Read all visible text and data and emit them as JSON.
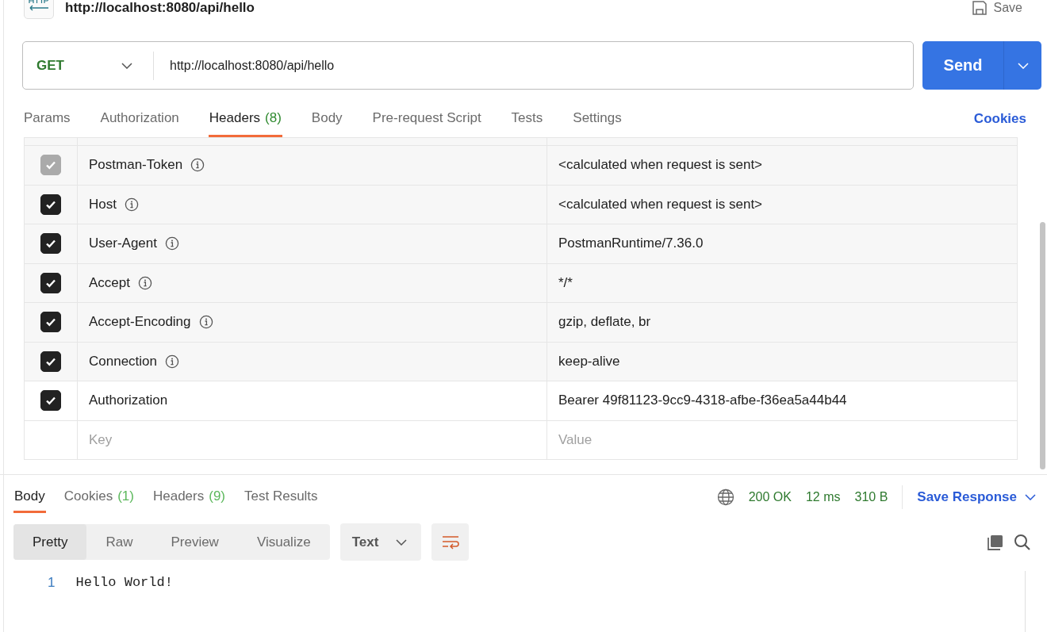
{
  "request": {
    "title": "http://localhost:8080/api/hello",
    "save_label": "Save",
    "method": "GET",
    "url": "http://localhost:8080/api/hello",
    "send_label": "Send"
  },
  "request_tabs": [
    {
      "label": "Params",
      "selected": false
    },
    {
      "label": "Authorization",
      "selected": false
    },
    {
      "label": "Headers",
      "count": "(8)",
      "selected": true
    },
    {
      "label": "Body",
      "selected": false
    },
    {
      "label": "Pre-request Script",
      "selected": false
    },
    {
      "label": "Tests",
      "selected": false
    },
    {
      "label": "Settings",
      "selected": false
    }
  ],
  "cookies_link": "Cookies",
  "headers": [
    {
      "key": "Postman-Token",
      "value": "<calculated when request is sent>",
      "checked": true,
      "disabled": true,
      "hint": true
    },
    {
      "key": "Host",
      "value": "<calculated when request is sent>",
      "checked": true,
      "disabled": false,
      "hint": true
    },
    {
      "key": "User-Agent",
      "value": "PostmanRuntime/7.36.0",
      "checked": true,
      "disabled": false,
      "hint": true
    },
    {
      "key": "Accept",
      "value": "*/*",
      "checked": true,
      "disabled": false,
      "hint": true
    },
    {
      "key": "Accept-Encoding",
      "value": "gzip, deflate, br",
      "checked": true,
      "disabled": false,
      "hint": true
    },
    {
      "key": "Connection",
      "value": "keep-alive",
      "checked": true,
      "disabled": false,
      "hint": true
    },
    {
      "key": "Authorization",
      "value": "Bearer 49f81123-9cc9-4318-afbe-f36ea5a44b44",
      "checked": true,
      "disabled": false,
      "hint": false
    }
  ],
  "new_header": {
    "key_placeholder": "Key",
    "value_placeholder": "Value"
  },
  "response_tabs": [
    {
      "label": "Body",
      "selected": true
    },
    {
      "label": "Cookies",
      "count": "(1)",
      "selected": false
    },
    {
      "label": "Headers",
      "count": "(9)",
      "selected": false
    },
    {
      "label": "Test Results",
      "selected": false
    }
  ],
  "status": {
    "code": "200 OK",
    "time": "12 ms",
    "size": "310 B",
    "save_label": "Save Response"
  },
  "view_modes": [
    {
      "label": "Pretty",
      "selected": true
    },
    {
      "label": "Raw",
      "selected": false
    },
    {
      "label": "Preview",
      "selected": false
    },
    {
      "label": "Visualize",
      "selected": false
    }
  ],
  "format": "Text",
  "body_lines": [
    {
      "number": "1",
      "text": "Hello World!"
    }
  ]
}
